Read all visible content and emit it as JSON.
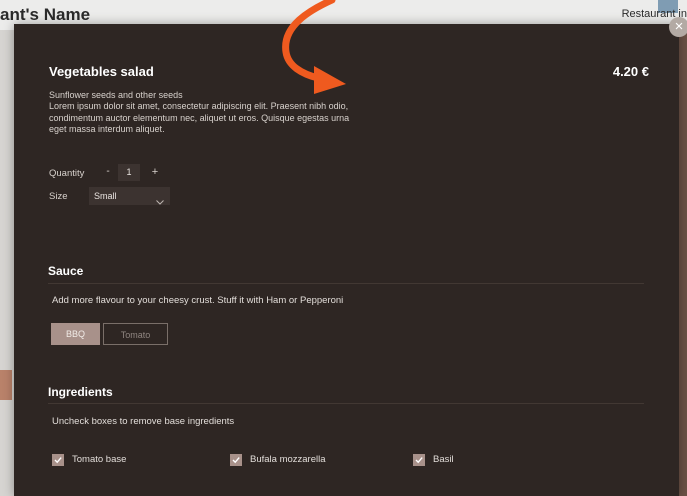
{
  "background": {
    "restaurant_title": "ant's Name",
    "top_right_link": "Restaurant in"
  },
  "modal": {
    "close_symbol": "×",
    "item": {
      "name": "Vegetables salad",
      "price": "4.20 €",
      "subtitle": "Sunflower seeds and other seeds",
      "description": "Lorem ipsum dolor sit amet, consectetur adipiscing elit. Praesent nibh odio, condimentum auctor elementum nec, aliquet ut eros. Quisque egestas urna eget massa interdum aliquet."
    },
    "quantity": {
      "label": "Quantity",
      "minus": "-",
      "value": "1",
      "plus": "+"
    },
    "size": {
      "label": "Size",
      "selected": "Small"
    },
    "sauce": {
      "title": "Sauce",
      "description": "Add more flavour to your cheesy crust. Stuff it with Ham or Pepperoni",
      "options": [
        {
          "label": "BBQ",
          "selected": true
        },
        {
          "label": "Tomato",
          "selected": false
        }
      ]
    },
    "ingredients": {
      "title": "Ingredients",
      "description": "Uncheck boxes to remove base ingredients",
      "items": [
        {
          "label": "Tomato base",
          "checked": true
        },
        {
          "label": "Bufala mozzarella",
          "checked": true
        },
        {
          "label": "Basil",
          "checked": true
        }
      ]
    }
  },
  "colors": {
    "modal_bg": "#2e2623",
    "accent_selected": "#a8918a",
    "annotation_arrow": "#ef5a1f"
  }
}
